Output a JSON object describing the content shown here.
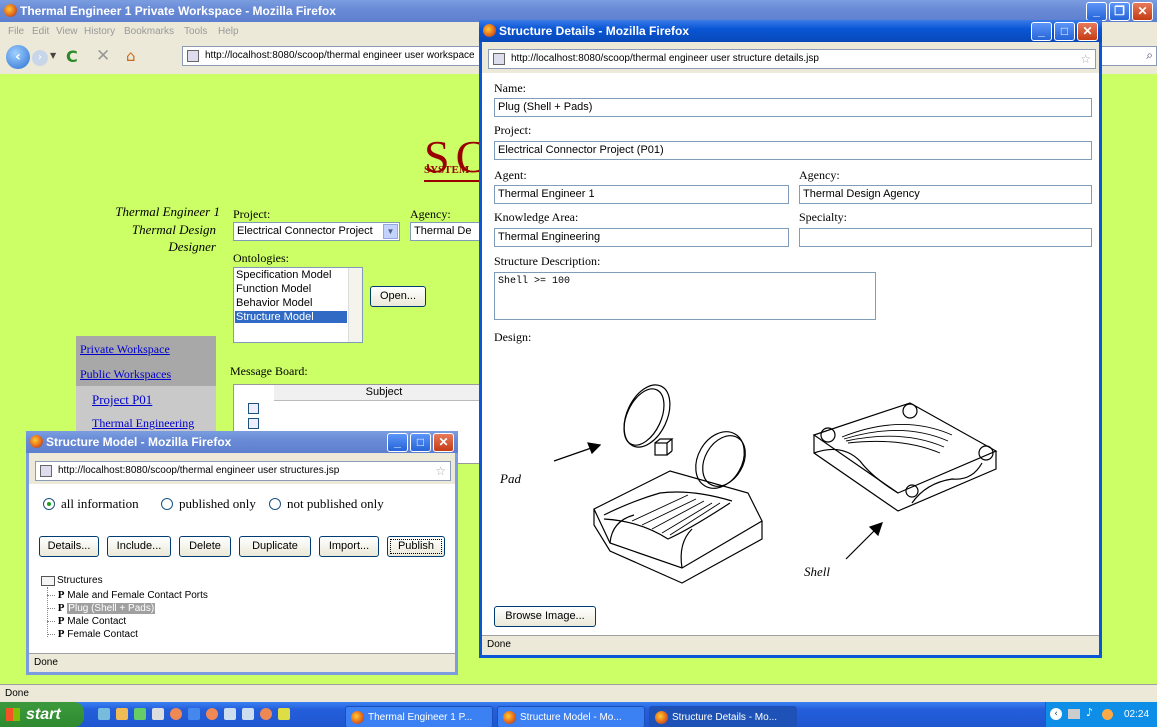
{
  "main_window": {
    "title": "Thermal Engineer 1 Private Workspace - Mozilla Firefox",
    "menu": [
      "File",
      "Edit",
      "View",
      "History",
      "Bookmarks",
      "Tools",
      "Help"
    ],
    "url": "http://localhost:8080/scoop/thermal engineer user workspace",
    "status": "Done",
    "logo": "SC",
    "logo_sub": "SYSTEM",
    "user": {
      "name": "Thermal Engineer 1",
      "role": "Thermal Design",
      "role2": "Designer"
    },
    "project_label": "Project:",
    "project_value": "Electrical Connector Project",
    "agency_label": "Agency:",
    "agency_value": "Thermal De",
    "ontologies_label": "Ontologies:",
    "ontologies": [
      "Specification Model",
      "Function Model",
      "Behavior Model",
      "Structure Model"
    ],
    "ontology_selected": "Structure Model",
    "open_button": "Open...",
    "nav": {
      "private": "Private Workspace",
      "public": "Public Workspaces",
      "project": "Project P01",
      "thermal": "Thermal Engineering"
    },
    "message_board_label": "Message Board:",
    "message_board_header": "Subject"
  },
  "structure_model_window": {
    "title": "Structure Model - Mozilla Firefox",
    "url": "http://localhost:8080/scoop/thermal engineer user structures.jsp",
    "filters": [
      "all information",
      "published only",
      "not published only"
    ],
    "filter_selected": "all information",
    "buttons": [
      "Details...",
      "Include...",
      "Delete",
      "Duplicate",
      "Import...",
      "Publish"
    ],
    "tree_root": "Structures",
    "tree_items": [
      {
        "marker": "P",
        "label": "Male and Female Contact Ports"
      },
      {
        "marker": "P",
        "label": "Plug (Shell + Pads)"
      },
      {
        "marker": "P",
        "label": "Male Contact"
      },
      {
        "marker": "P",
        "label": "Female Contact"
      }
    ],
    "tree_selected": "Plug (Shell + Pads)",
    "status": "Done"
  },
  "details_window": {
    "title": "Structure Details - Mozilla Firefox",
    "url": "http://localhost:8080/scoop/thermal engineer user structure details.jsp",
    "name_label": "Name:",
    "name_value": "Plug (Shell + Pads)",
    "project_label": "Project:",
    "project_value": "Electrical Connector Project (P01)",
    "agent_label": "Agent:",
    "agent_value": "Thermal Engineer 1",
    "agency_label": "Agency:",
    "agency_value": "Thermal Design Agency",
    "knowledge_label": "Knowledge Area:",
    "knowledge_value": "Thermal Engineering",
    "specialty_label": "Specialty:",
    "specialty_value": "",
    "description_label": "Structure Description:",
    "description_value": "Shell >= 100",
    "design_label": "Design:",
    "pad_label": "Pad",
    "shell_label": "Shell",
    "browse_button": "Browse Image...",
    "status": "Done"
  },
  "taskbar": {
    "start": "start",
    "tasks": [
      "Thermal Engineer 1 P...",
      "Structure Model - Mo...",
      "Structure Details - Mo..."
    ],
    "active_task": "Structure Details - Mo...",
    "clock": "02:24"
  },
  "colors": {
    "page_bg": "#ccff66",
    "xp_blue": "#0a56d6",
    "selection": "#316ac5"
  }
}
